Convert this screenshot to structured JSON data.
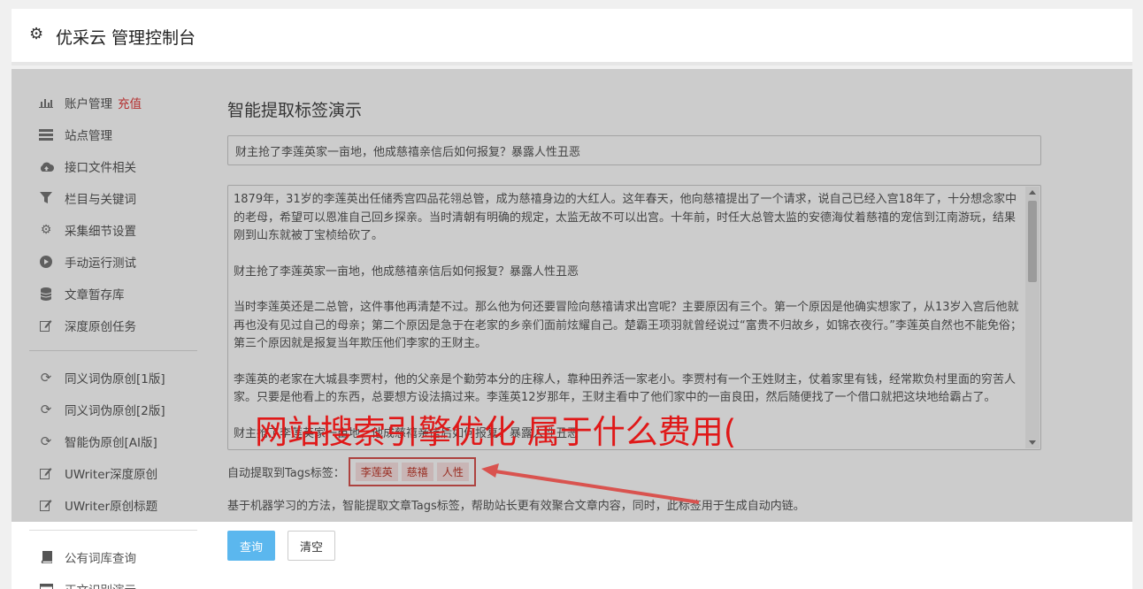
{
  "header": {
    "title": "优采云 管理控制台",
    "icon": "gear-icon"
  },
  "sidebar": {
    "group1": [
      {
        "label": "账户管理",
        "badge": "充值",
        "icon": "bar-chart-icon"
      },
      {
        "label": "站点管理",
        "icon": "list-icon"
      },
      {
        "label": "接口文件相关",
        "icon": "cloud-upload-icon"
      },
      {
        "label": "栏目与关键词",
        "icon": "filter-icon"
      },
      {
        "label": "采集细节设置",
        "icon": "gears-icon"
      },
      {
        "label": "手动运行测试",
        "icon": "play-circle-icon"
      },
      {
        "label": "文章暂存库",
        "icon": "database-icon"
      },
      {
        "label": "深度原创任务",
        "icon": "edit-icon"
      }
    ],
    "group2": [
      {
        "label": "同义词伪原创[1版]",
        "icon": "refresh-icon"
      },
      {
        "label": "同义词伪原创[2版]",
        "icon": "refresh-icon"
      },
      {
        "label": "智能伪原创[AI版]",
        "icon": "refresh-icon"
      },
      {
        "label": "UWriter深度原创",
        "icon": "edit-icon"
      },
      {
        "label": "UWriter原创标题",
        "icon": "edit-icon"
      }
    ],
    "group3": [
      {
        "label": "公有词库查询",
        "icon": "book-icon"
      },
      {
        "label": "正文识别演示",
        "icon": "window-icon"
      }
    ]
  },
  "main": {
    "heading": "智能提取标签演示",
    "title_value": "财主抢了李莲英家一亩地，他成慈禧亲信后如何报复？暴露人性丑恶",
    "paragraphs": [
      "1879年，31岁的李莲英出任储秀宫四品花翎总管，成为慈禧身边的大红人。这年春天，他向慈禧提出了一个请求，说自己已经入宫18年了，十分想念家中的老母，希望可以恩准自己回乡探亲。当时清朝有明确的规定，太监无故不可以出宫。十年前，时任大总管太监的安德海仗着慈禧的宠信到江南游玩，结果刚到山东就被丁宝桢给砍了。",
      "财主抢了李莲英家一亩地，他成慈禧亲信后如何报复？暴露人性丑恶",
      "当时李莲英还是二总管，这件事他再清楚不过。那么他为何还要冒险向慈禧请求出宫呢？主要原因有三个。第一个原因是他确实想家了，从13岁入宫后他就再也没有见过自己的母亲；第二个原因是急于在老家的乡亲们面前炫耀自己。楚霸王项羽就曾经说过“富贵不归故乡，如锦衣夜行。”李莲英自然也不能免俗；第三个原因就是报复当年欺压他们李家的王财主。",
      "李莲英的老家在大城县李贾村，他的父亲是个勤劳本分的庄稼人，靠种田养活一家老小。李贾村有一个王姓财主，仗着家里有钱，经常欺负村里面的穷苦人家。只要是他看上的东西，总要想方设法搞过来。李莲英12岁那年，王财主看中了他们家中的一亩良田，然后随便找了一个借口就把这块地给霸占了。",
      "财主抢了李莲英家一亩地，他成慈禧亲信后如何报复？暴露人性丑恶"
    ],
    "tags_label": "自动提取到Tags标签：",
    "tags": [
      "李莲英",
      "慈禧",
      "人性"
    ],
    "description": "基于机器学习的方法，智能提取文章Tags标签，帮助站长更有效聚合文章内容，同时，此标签用于生成自动内链。",
    "query_button": "查询",
    "clear_button": "清空"
  },
  "watermark": "网站搜索引擎优化 属于什么费用("
}
